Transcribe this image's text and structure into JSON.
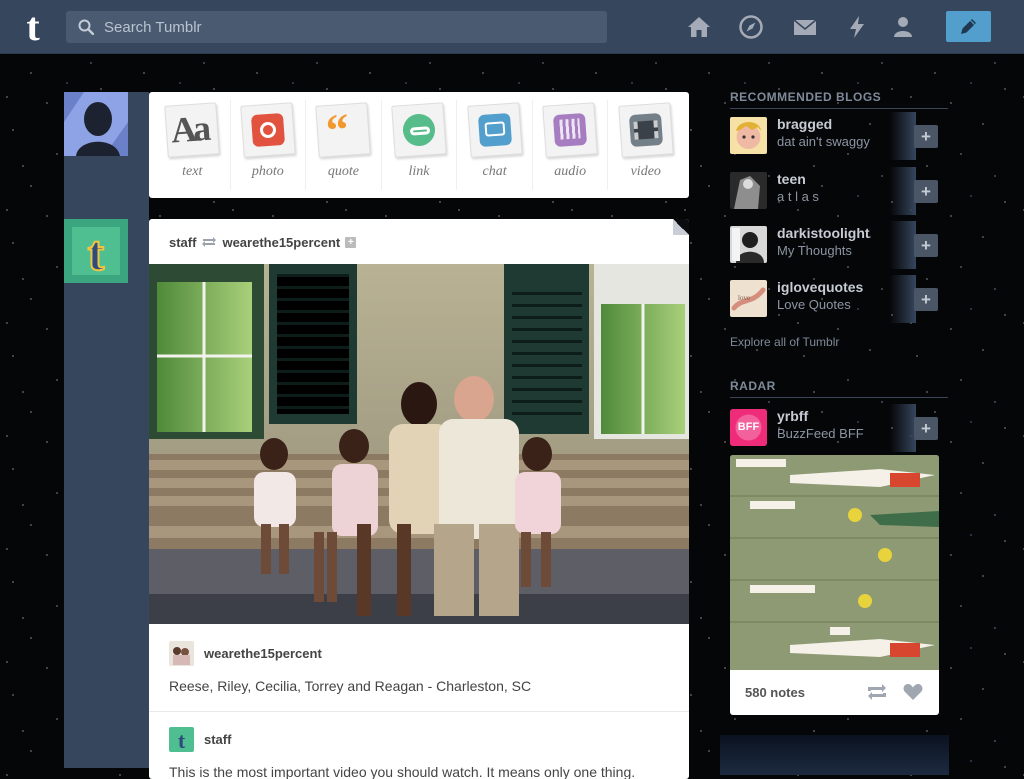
{
  "topbar": {
    "search_placeholder": "Search Tumblr",
    "logo_text": "t",
    "nav_icons": [
      "home-icon",
      "explore-icon",
      "inbox-icon",
      "activity-icon",
      "account-icon"
    ],
    "compose_icon": "pencil-icon",
    "accent": "#529ecc",
    "bar_color": "#36465d"
  },
  "post_types": [
    {
      "label": "text",
      "color": "#e8e8e8"
    },
    {
      "label": "photo",
      "color": "#e2533f"
    },
    {
      "label": "quote",
      "color": "#f2992e"
    },
    {
      "label": "link",
      "color": "#56bc8a"
    },
    {
      "label": "chat",
      "color": "#529ecc"
    },
    {
      "label": "audio",
      "color": "#a77dc2"
    },
    {
      "label": "video",
      "color": "#748089"
    }
  ],
  "post": {
    "reblogger": "staff",
    "source": "wearethe15percent",
    "caption_user": "wearethe15percent",
    "caption": "Reese, Riley, Cecilia, Torrey and Reagan - Charleston, SC",
    "next_user": "staff",
    "next_text": "This is the most important video you should watch. It means only one thing."
  },
  "sidebar": {
    "recommended_title": "RECOMMENDED BLOGS",
    "recommended": [
      {
        "name": "bragged",
        "subtitle": "dat ain't swaggy"
      },
      {
        "name": "teen",
        "subtitle": "a t l a s"
      },
      {
        "name": "darkistoolight",
        "subtitle": "My Thoughts"
      },
      {
        "name": "iglovequotes",
        "subtitle": "Love Quotes"
      }
    ],
    "explore_link": "Explore all of Tumblr",
    "radar_title": "RADAR",
    "radar": {
      "name": "yrbff",
      "subtitle": "BuzzFeed BFF",
      "notes": "580 notes",
      "avatar_text": "BFF"
    }
  }
}
